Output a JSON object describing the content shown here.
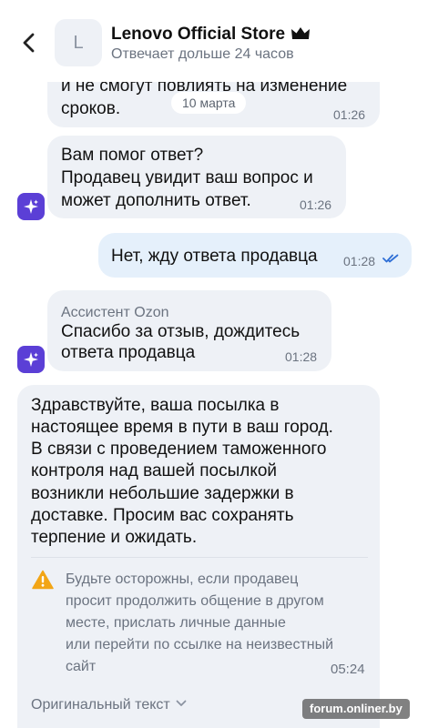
{
  "header": {
    "avatar_letter": "L",
    "store_name": "Lenovo Official Store",
    "status": "Отвечает дольше 24 часов"
  },
  "date_pill": "10 марта",
  "messages": [
    {
      "lines": [
        "и не смогут повлиять на изменение",
        "сроков."
      ],
      "time": "01:26"
    },
    {
      "lines": [
        "Вам помог ответ?",
        "Продавец увидит ваш вопрос и",
        "может дополнить ответ."
      ],
      "time": "01:26"
    },
    {
      "lines": [
        "Нет, жду ответа продавца"
      ],
      "time": "01:28"
    },
    {
      "sender": "Ассистент Ozon",
      "lines": [
        "Спасибо за отзыв, дождитесь",
        "ответа продавца"
      ],
      "time": "01:28"
    },
    {
      "lines": [
        "Здравствуйте, ваша посылка в",
        "настоящее время в пути в ваш город.",
        "В связи с проведением таможенного",
        "контроля над вашей посылкой",
        "возникли небольшие задержки в",
        "доставке. Просим вас сохранять",
        "терпение и ожидать."
      ],
      "warning": [
        "Будьте осторожны, если продавец",
        "просит продолжить общение в другом",
        "месте, прислать личные данные",
        "или перейти по ссылке на неизвестный",
        "сайт"
      ],
      "time": "05:24",
      "original_text_label": "Оригинальный текст"
    }
  ],
  "watermark": "forum.onliner.by",
  "colors": {
    "assistant_icon": "#5b3fd6",
    "read_check": "#2f6fd6",
    "warning": "#f2a516",
    "bubble_in": "#eef1f6",
    "bubble_out": "#e5f0fb"
  },
  "icons": {
    "back": "chevron-left-icon",
    "crown": "crown-icon",
    "assistant": "sparkle-icon",
    "read": "double-check-icon",
    "warning": "warning-icon",
    "expand": "chevron-down-icon"
  }
}
